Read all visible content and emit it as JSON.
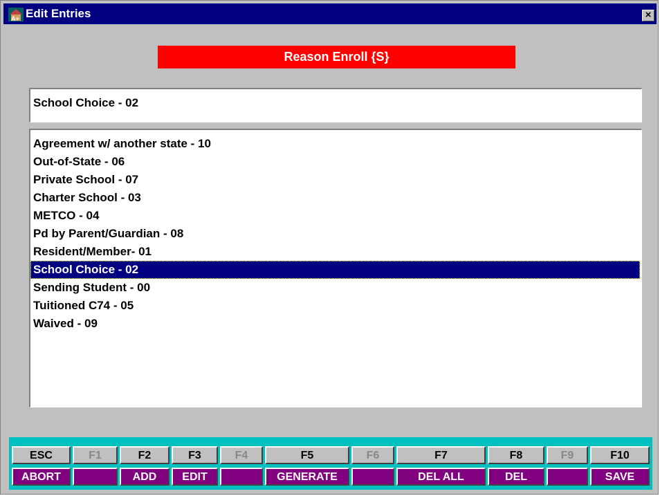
{
  "window": {
    "title": "Edit Entries",
    "close_label": "×"
  },
  "banner": {
    "text": "Reason Enroll {S}"
  },
  "current_value": "School Choice - 02",
  "list": {
    "items": [
      "Agreement w/ another state - 10",
      "Out-of-State - 06",
      "Private School - 07",
      "Charter School - 03",
      "METCO - 04",
      "Pd by Parent/Guardian - 08",
      "Resident/Member- 01",
      "School Choice - 02",
      "Sending Student - 00",
      "Tuitioned C74 - 05",
      "Waived - 09"
    ],
    "selected_index": 7
  },
  "fkeys": [
    {
      "key": "ESC",
      "action": "ABORT",
      "enabled": true
    },
    {
      "key": "F1",
      "action": "",
      "enabled": false
    },
    {
      "key": "F2",
      "action": "ADD",
      "enabled": true
    },
    {
      "key": "F3",
      "action": "EDIT",
      "enabled": true
    },
    {
      "key": "F4",
      "action": "",
      "enabled": false
    },
    {
      "key": "F5",
      "action": "GENERATE",
      "enabled": true
    },
    {
      "key": "F6",
      "action": "",
      "enabled": false
    },
    {
      "key": "F7",
      "action": "DEL ALL",
      "enabled": true
    },
    {
      "key": "F8",
      "action": "DEL",
      "enabled": true
    },
    {
      "key": "F9",
      "action": "",
      "enabled": false
    },
    {
      "key": "F10",
      "action": "SAVE",
      "enabled": true
    }
  ],
  "colors": {
    "titlebar": "#000080",
    "banner": "#ff0000",
    "selection": "#000080",
    "fkey_bar": "#00c0c0",
    "fkey_action": "#800080"
  }
}
